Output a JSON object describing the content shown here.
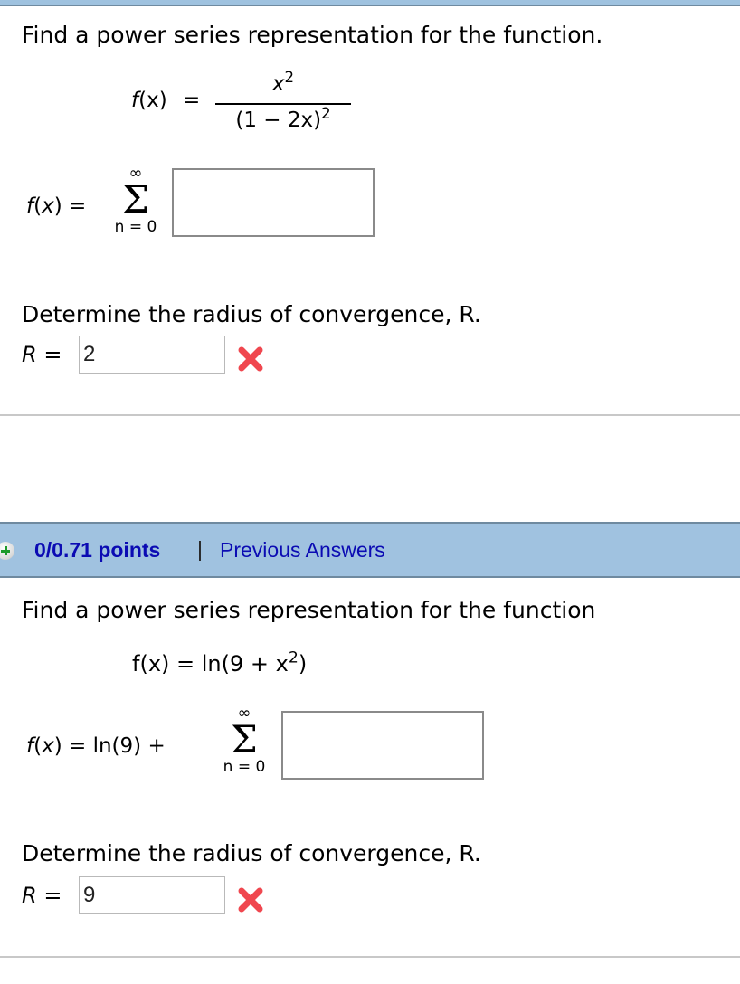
{
  "question1": {
    "prompt": "Find a power series representation for the function.",
    "function": {
      "lhs_f": "f",
      "lhs_x": "(x)",
      "equals": "=",
      "numerator_x": "x",
      "numerator_exp": "2",
      "denominator_base": "(1 − 2x)",
      "denominator_exp": "2"
    },
    "series": {
      "lhs": "f(x) =",
      "upper": "∞",
      "sigma": "Σ",
      "lower": "n = 0",
      "answer_value": ""
    },
    "radius_prompt": "Determine the radius of convergence, R.",
    "radius_label": "R =",
    "radius_value": "2",
    "radius_status": "incorrect"
  },
  "question2": {
    "points": "0/0.71 points",
    "separator": "|",
    "previous_answers_link": "Previous Answers",
    "prompt": "Find a power series representation for the function",
    "function": {
      "lhs": "f(x) = ln(9 + x",
      "exp": "2",
      "close": ")"
    },
    "series": {
      "lhs": "f(x) = ln(9) +",
      "upper": "∞",
      "sigma": "Σ",
      "lower": "n = 0",
      "answer_value": ""
    },
    "radius_prompt": "Determine the radius of convergence, R.",
    "radius_label": "R =",
    "radius_value": "9",
    "radius_status": "incorrect"
  },
  "colors": {
    "header_bar": "#a0c2e0",
    "link": "#0b0bb3",
    "incorrect_icon": "#f0474f",
    "plus_icon": "#1d9a2a"
  }
}
